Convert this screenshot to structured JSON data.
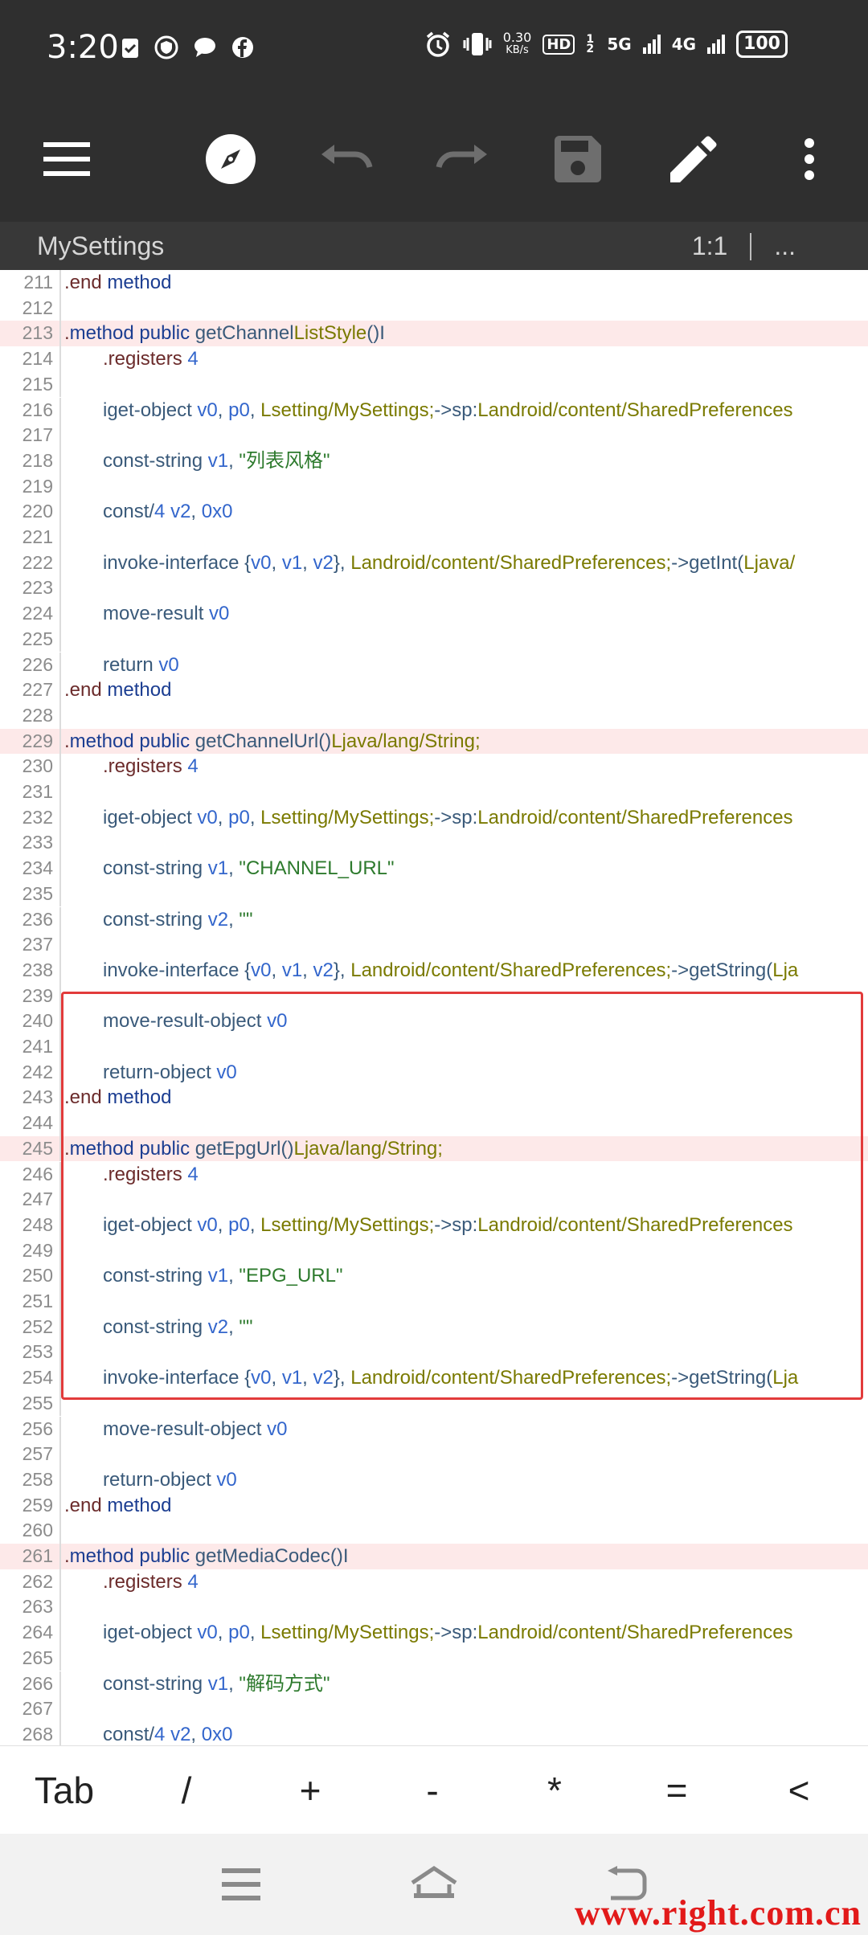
{
  "status_bar": {
    "time": "3:20",
    "net_speed_value": "0.30",
    "net_speed_unit": "KB/s",
    "hd_badge": "HD",
    "sim_slot": "1 2",
    "net1": "5G",
    "net2": "4G",
    "battery": "100"
  },
  "toolbar": {
    "icons": [
      "menu-icon",
      "compass-icon",
      "undo-icon",
      "redo-icon",
      "save-icon",
      "edit-icon",
      "more-icon"
    ]
  },
  "file_bar": {
    "filename": "MySettings",
    "cursor_position": "1:1",
    "more": "..."
  },
  "editor": {
    "lines": [
      {
        "n": "211",
        "text": ".end method"
      },
      {
        "n": "212",
        "text": ""
      },
      {
        "n": "213",
        "text": ".method public getChannelListStyle()I"
      },
      {
        "n": "214",
        "text": ".registers 4"
      },
      {
        "n": "215",
        "text": ""
      },
      {
        "n": "216",
        "text": "iget-object v0, p0, Lsetting/MySettings;->sp:Landroid/content/SharedPreferences"
      },
      {
        "n": "217",
        "text": ""
      },
      {
        "n": "218",
        "text": "const-string v1, \"列表风格\""
      },
      {
        "n": "219",
        "text": ""
      },
      {
        "n": "220",
        "text": "const/4 v2, 0x0"
      },
      {
        "n": "221",
        "text": ""
      },
      {
        "n": "222",
        "text": "invoke-interface {v0, v1, v2}, Landroid/content/SharedPreferences;->getInt(Ljava/"
      },
      {
        "n": "223",
        "text": ""
      },
      {
        "n": "224",
        "text": "move-result v0"
      },
      {
        "n": "225",
        "text": ""
      },
      {
        "n": "226",
        "text": "return v0"
      },
      {
        "n": "227",
        "text": ".end method"
      },
      {
        "n": "228",
        "text": ""
      },
      {
        "n": "229",
        "text": ".method public getChannelUrl()Ljava/lang/String;"
      },
      {
        "n": "230",
        "text": ".registers 4"
      },
      {
        "n": "231",
        "text": ""
      },
      {
        "n": "232",
        "text": "iget-object v0, p0, Lsetting/MySettings;->sp:Landroid/content/SharedPreferences"
      },
      {
        "n": "233",
        "text": ""
      },
      {
        "n": "234",
        "text": "const-string v1, \"CHANNEL_URL\""
      },
      {
        "n": "235",
        "text": ""
      },
      {
        "n": "236",
        "text": "const-string v2, \"\""
      },
      {
        "n": "237",
        "text": ""
      },
      {
        "n": "238",
        "text": "invoke-interface {v0, v1, v2}, Landroid/content/SharedPreferences;->getString(Lja"
      },
      {
        "n": "239",
        "text": ""
      },
      {
        "n": "240",
        "text": "move-result-object v0"
      },
      {
        "n": "241",
        "text": ""
      },
      {
        "n": "242",
        "text": "return-object v0"
      },
      {
        "n": "243",
        "text": ".end method"
      },
      {
        "n": "244",
        "text": ""
      },
      {
        "n": "245",
        "text": ".method public getEpgUrl()Ljava/lang/String;"
      },
      {
        "n": "246",
        "text": ".registers 4"
      },
      {
        "n": "247",
        "text": ""
      },
      {
        "n": "248",
        "text": "iget-object v0, p0, Lsetting/MySettings;->sp:Landroid/content/SharedPreferences"
      },
      {
        "n": "249",
        "text": ""
      },
      {
        "n": "250",
        "text": "const-string v1, \"EPG_URL\""
      },
      {
        "n": "251",
        "text": ""
      },
      {
        "n": "252",
        "text": "const-string v2, \"\""
      },
      {
        "n": "253",
        "text": ""
      },
      {
        "n": "254",
        "text": "invoke-interface {v0, v1, v2}, Landroid/content/SharedPreferences;->getString(Lja"
      },
      {
        "n": "255",
        "text": ""
      },
      {
        "n": "256",
        "text": "move-result-object v0"
      },
      {
        "n": "257",
        "text": ""
      },
      {
        "n": "258",
        "text": "return-object v0"
      },
      {
        "n": "259",
        "text": ".end method"
      },
      {
        "n": "260",
        "text": ""
      },
      {
        "n": "261",
        "text": ".method public getMediaCodec()I"
      },
      {
        "n": "262",
        "text": ".registers 4"
      },
      {
        "n": "263",
        "text": ""
      },
      {
        "n": "264",
        "text": "iget-object v0, p0, Lsetting/MySettings;->sp:Landroid/content/SharedPreferences"
      },
      {
        "n": "265",
        "text": ""
      },
      {
        "n": "266",
        "text": "const-string v1, \"解码方式\""
      },
      {
        "n": "267",
        "text": ""
      },
      {
        "n": "268",
        "text": "const/4 v2, 0x0"
      }
    ]
  },
  "keybar": {
    "keys": [
      "Tab",
      "/",
      "+",
      "-",
      "*",
      "=",
      "<"
    ]
  },
  "nav": {
    "icons": [
      "recent-apps-icon",
      "home-icon",
      "back-icon"
    ]
  },
  "watermark": "www.right.com.cn"
}
